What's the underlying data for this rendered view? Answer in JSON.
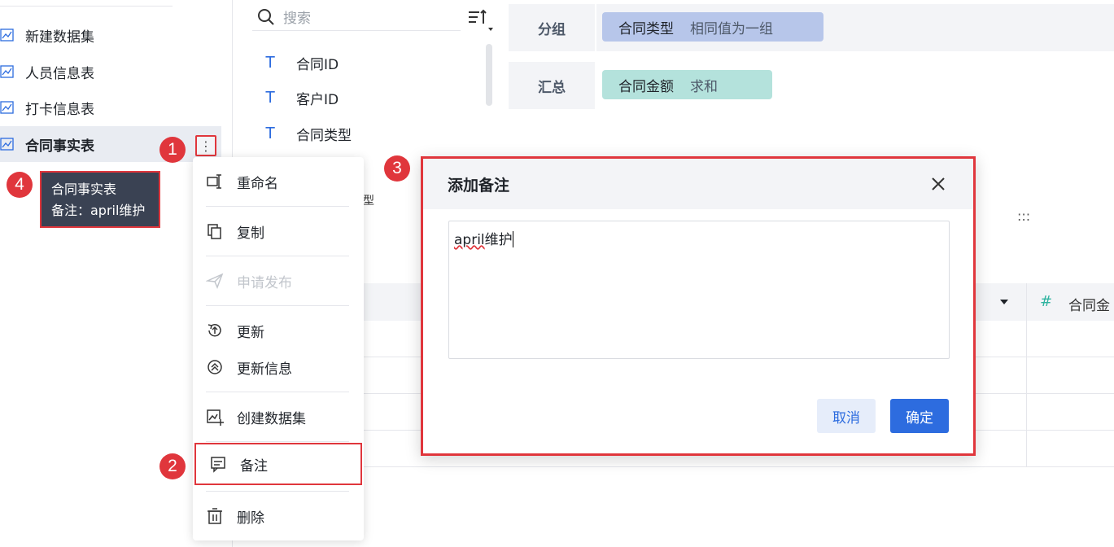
{
  "datasets": [
    {
      "label": "新建数据集"
    },
    {
      "label": "人员信息表"
    },
    {
      "label": "打卡信息表"
    },
    {
      "label": "合同事实表"
    }
  ],
  "more_button": {
    "label": "⋮"
  },
  "tooltip": {
    "line1": "合同事实表",
    "line2": "备注：april维护"
  },
  "badges": {
    "b1": "1",
    "b2": "2",
    "b3": "3",
    "b4": "4"
  },
  "search": {
    "placeholder": "搜索"
  },
  "fields": [
    {
      "type": "T",
      "label": "合同ID"
    },
    {
      "type": "T",
      "label": "客户ID"
    },
    {
      "type": "T",
      "label": "合同类型"
    }
  ],
  "config": {
    "group_label": "分组",
    "group_chip": {
      "name": "合同类型",
      "sub": "相同值为一组"
    },
    "summary_label": "汇总",
    "summary_chip": {
      "name": "合同金额",
      "sub": "求和"
    }
  },
  "table": {
    "partial_header": "型",
    "hash_symbol": "#",
    "amount_col": "合同金",
    "dots": ":::"
  },
  "menu": {
    "items": [
      {
        "label": "重命名",
        "icon": "rename-icon"
      },
      {
        "label": "复制",
        "icon": "copy-icon"
      },
      {
        "label": "申请发布",
        "icon": "send-icon"
      },
      {
        "label": "更新",
        "icon": "update-icon"
      },
      {
        "label": "更新信息",
        "icon": "update-info-icon"
      },
      {
        "label": "创建数据集",
        "icon": "create-dataset-icon"
      },
      {
        "label": "备注",
        "icon": "note-icon"
      },
      {
        "label": "删除",
        "icon": "trash-icon"
      }
    ]
  },
  "dialog": {
    "title": "添加备注",
    "text_underlined": "april",
    "text_rest": "维护",
    "cancel_label": "取消",
    "ok_label": "确定"
  },
  "colors": {
    "accent": "#2d6cdf",
    "highlight_red": "#e0363c",
    "chip_blue": "#b7c6ea",
    "chip_green": "#b4e2dc"
  }
}
